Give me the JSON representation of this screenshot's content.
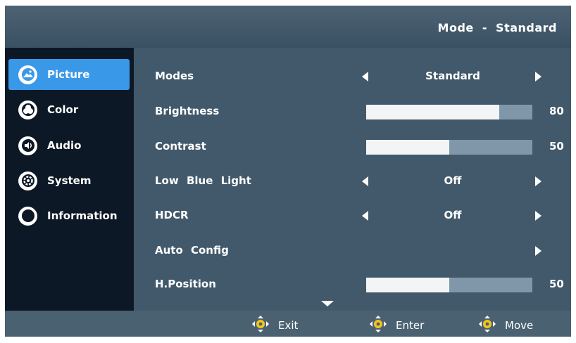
{
  "header": {
    "mode_text": "Mode - Standard"
  },
  "sidebar": {
    "items": [
      {
        "label": "Picture",
        "icon": "picture-icon",
        "active": true
      },
      {
        "label": "Color",
        "icon": "color-icon",
        "active": false
      },
      {
        "label": "Audio",
        "icon": "audio-icon",
        "active": false
      },
      {
        "label": "System",
        "icon": "system-icon",
        "active": false
      },
      {
        "label": "Information",
        "icon": "information-icon",
        "active": false
      }
    ]
  },
  "settings": {
    "modes": {
      "label": "Modes",
      "value": "Standard"
    },
    "brightness": {
      "label": "Brightness",
      "value": "80",
      "level": 0.8
    },
    "contrast": {
      "label": "Contrast",
      "value": "50",
      "level": 0.5
    },
    "low_blue_light": {
      "label": "Low Blue Light",
      "value": "Off"
    },
    "hdcr": {
      "label": "HDCR",
      "value": "Off"
    },
    "auto_config": {
      "label": "Auto Config"
    },
    "h_position": {
      "label": "H.Position",
      "value": "50",
      "level": 0.5
    }
  },
  "footer": {
    "exit_label": "Exit",
    "enter_label": "Enter",
    "move_label": "Move",
    "icon": "joystick-icon"
  },
  "colors": {
    "accent": "#3a98e8",
    "joystick": "#f5c518",
    "sidebar_bg": "#0d1826",
    "content_bg": "#41596b",
    "slider_fill": "#f2f4f5",
    "slider_track": "#7f97a8"
  }
}
